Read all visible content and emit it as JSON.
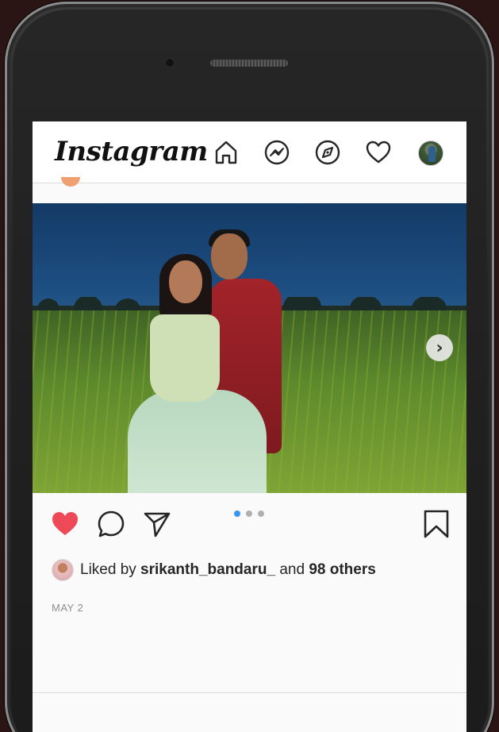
{
  "app": {
    "logo_text": "Instagram"
  },
  "nav": {
    "icons": [
      "home-icon",
      "messenger-icon",
      "explore-icon",
      "activity-heart-icon",
      "profile-avatar"
    ]
  },
  "post": {
    "carousel": {
      "total": 3,
      "active_index": 0
    },
    "liked": true,
    "likes": {
      "prefix": "Liked by ",
      "user": "srikanth_bandaru_",
      "middle": " and ",
      "others": "98 others"
    },
    "date": "MAY 2"
  },
  "colors": {
    "like_red": "#ed4956",
    "dot_active": "#3897f0",
    "text": "#262626",
    "muted": "#8e8e8e"
  }
}
